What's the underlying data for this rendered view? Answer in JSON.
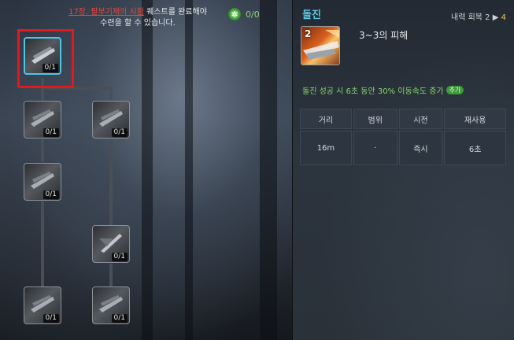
{
  "quest_notice": {
    "quest_link": "17장. 팔부기재의 시험",
    "line1_suffix": " 퀘스트를 완료해야",
    "line2": "수련을 할 수 있습니다."
  },
  "points": {
    "value": "0/0",
    "icon": "skill-point-icon"
  },
  "skill_tree": {
    "nodes": [
      {
        "id": "root",
        "level": "0/1",
        "selected": true
      },
      {
        "id": "left-1",
        "level": "0/1"
      },
      {
        "id": "right-1",
        "level": "0/1"
      },
      {
        "id": "left-2",
        "level": "0/1"
      },
      {
        "id": "right-2",
        "level": "0/1"
      },
      {
        "id": "left-3",
        "level": "0/1"
      },
      {
        "id": "right-3",
        "level": "0/1"
      }
    ]
  },
  "detail": {
    "skill_name": "돌진",
    "recovery_label": "내력 회복 2",
    "recovery_arrow": "▶",
    "recovery_next": "4",
    "icon_level": "2",
    "damage": "3~3의 피해",
    "effect": "돌진 성공 시 6초 동안 30% 이동속도 증가",
    "effect_badge": "추가",
    "table": {
      "headers": [
        "거리",
        "범위",
        "시전",
        "재사용"
      ],
      "values": [
        "16m",
        "·",
        "즉시",
        "6초"
      ]
    }
  },
  "colors": {
    "skill_name": "#5ec7e6",
    "effect_text": "#86d46e",
    "quest_link": "#e04a3a",
    "highlight": "#e0191e",
    "selected_border": "#4fc6e8"
  }
}
